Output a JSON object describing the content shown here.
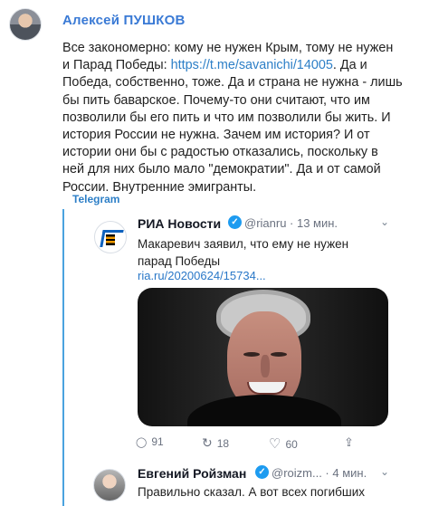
{
  "post": {
    "author": "Алексей ПУШКОВ",
    "text_lines": [
      "Все закономерно: кому не нужен Крым, тому не нужен",
      "и Парад Победы: ",
      "Победа, собственно, тоже. Да и страна не нужна - лишь",
      "бы пить баварское. Почему-то они считают, что им",
      "позволили бы его пить и что им позволили бы жить. И",
      "история России не нужна. Зачем им история? И от",
      "истории они бы с радостью отказались, поскольку в",
      "ней для них было мало \"демократии\". Да и от самой",
      "России. Внутренние эмигранты."
    ],
    "link": "https://t.me/savanichi/14005",
    "after_link": ". Да и",
    "source": "Telegram"
  },
  "embedded_tweet": {
    "name": "РИА Новости",
    "handle": "@rianru · 13 мин.",
    "text": "Макаревич заявил, что ему не нужен парад Победы",
    "link": "ria.ru/20200624/15734...",
    "replies": "91",
    "retweets": "18",
    "likes": "60"
  },
  "second_tweet": {
    "name": "Евгений Ройзман",
    "handle": "@roizm... · 4 мин.",
    "text": "Правильно сказал. А вот всех погибших"
  },
  "icons": {
    "avatar": "avatar",
    "verified": "verified-badge-icon",
    "chevron": "chevron-down-icon",
    "reply": "reply-icon",
    "retweet": "retweet-icon",
    "like": "heart-icon",
    "share": "share-icon"
  }
}
